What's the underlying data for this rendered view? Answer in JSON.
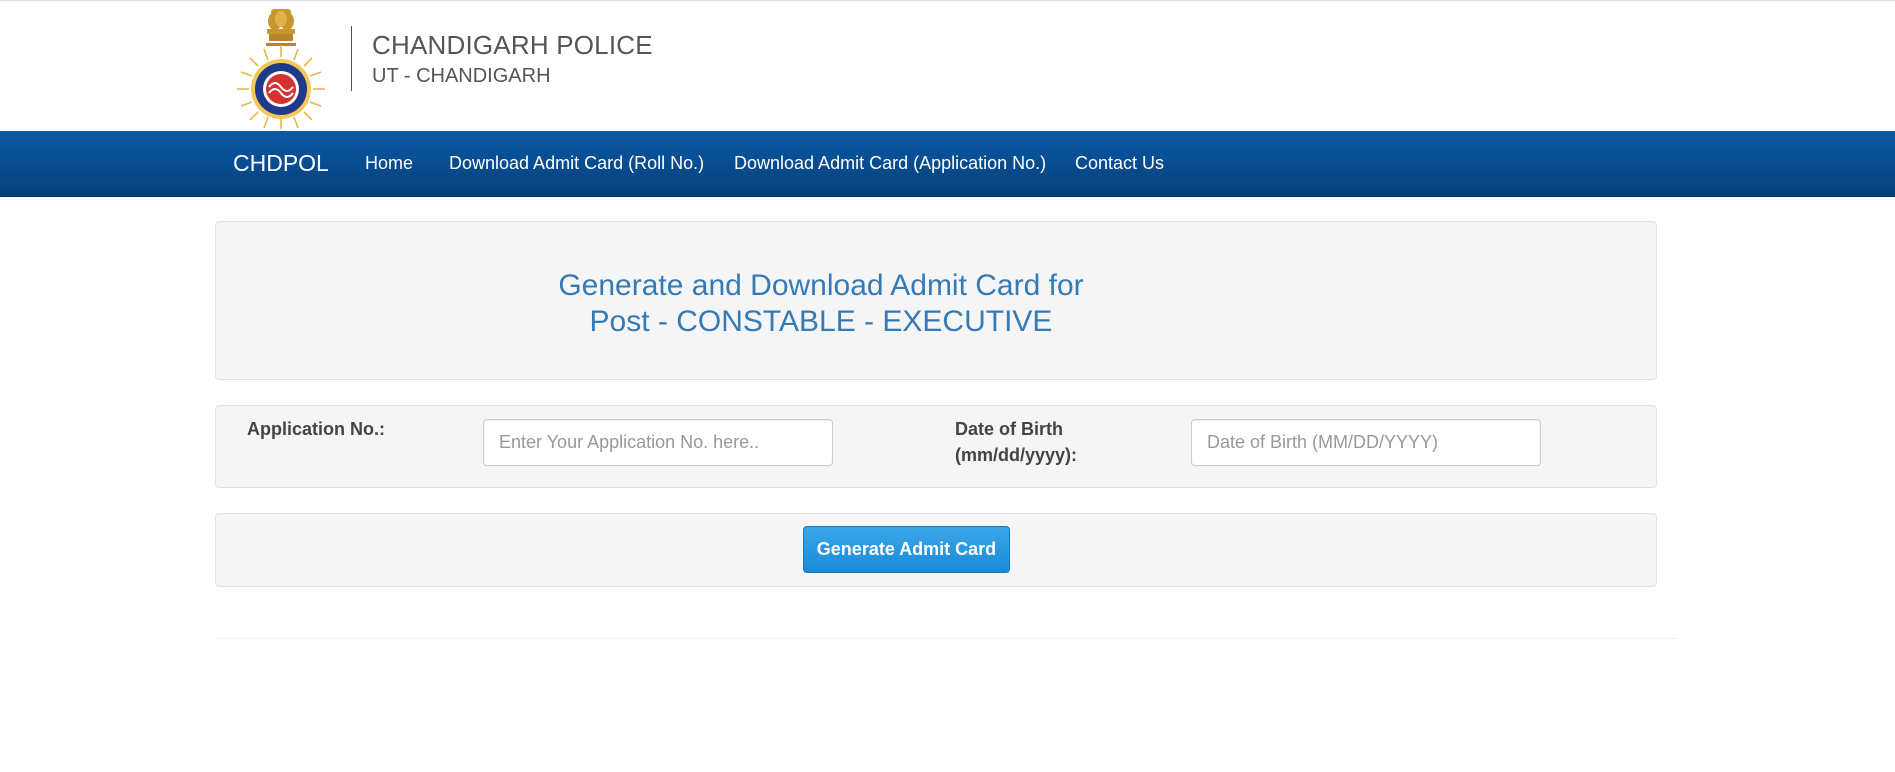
{
  "header": {
    "logo_icon": "chandigarh-police-emblem-icon",
    "org_title": "CHANDIGARH POLICE",
    "org_subtitle": "UT - CHANDIGARH"
  },
  "navbar": {
    "brand": "CHDPOL",
    "items": [
      {
        "label": "Home"
      },
      {
        "label": "Download Admit Card (Roll No.)"
      },
      {
        "label": "Download Admit Card (Application No.)"
      },
      {
        "label": "Contact Us"
      }
    ],
    "color_top": "#0a5aa6",
    "color_bottom": "#063f7a"
  },
  "title_panel": {
    "line1": "Generate and Download Admit Card for",
    "line2": "Post - CONSTABLE - EXECUTIVE",
    "color": "#337ab7"
  },
  "form": {
    "application_label": "Application No.:",
    "application_value": "",
    "application_placeholder": "Enter Your Application No. here..",
    "dob_label_line1": "Date of Birth",
    "dob_label_line2": "(mm/dd/yyyy):",
    "dob_value": "",
    "dob_placeholder": "Date of Birth (MM/DD/YYYY)"
  },
  "actions": {
    "generate_label": "Generate Admit Card",
    "button_color": "#1a8ad6"
  }
}
